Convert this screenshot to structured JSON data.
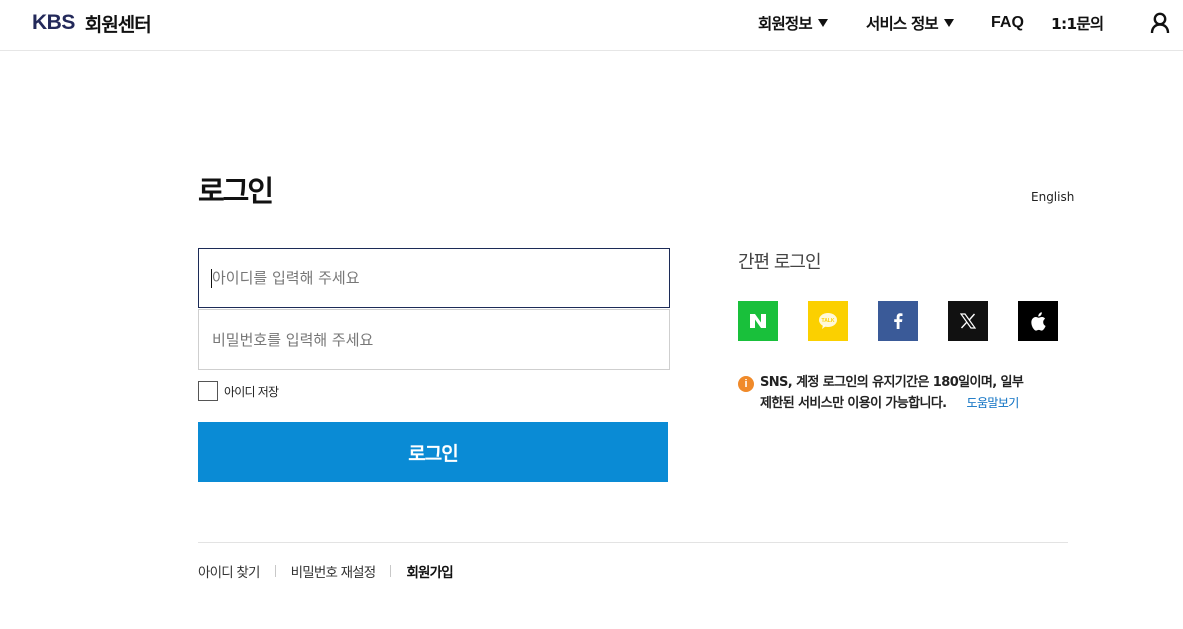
{
  "header": {
    "logo_brand": "KBS",
    "logo_title": "회원센터",
    "nav": [
      {
        "label": "회원정보",
        "has_dropdown": true
      },
      {
        "label": "서비스 정보",
        "has_dropdown": true
      },
      {
        "label": "FAQ",
        "has_dropdown": false
      },
      {
        "label": "1:1문의",
        "has_dropdown": false
      }
    ],
    "user_icon": "user-icon"
  },
  "login": {
    "title": "로그인",
    "language_link": "English",
    "id_placeholder": "아이디를 입력해 주세요",
    "pw_placeholder": "비밀번호를 입력해 주세요",
    "remember_label": "아이디 저장",
    "remember_checked": false,
    "submit_label": "로그인"
  },
  "bottom_links": {
    "find_id": "아이디 찾기",
    "reset_pw": "비밀번호 재설정",
    "signup": "회원가입"
  },
  "sns": {
    "title": "간편 로그인",
    "providers": [
      {
        "name": "naver",
        "icon": "naver-icon",
        "color": "#19c03b"
      },
      {
        "name": "kakao",
        "icon": "kakao-icon",
        "color": "#fbd000"
      },
      {
        "name": "facebook",
        "icon": "facebook-icon",
        "color": "#3a5a98"
      },
      {
        "name": "x",
        "icon": "x-icon",
        "color": "#111111"
      },
      {
        "name": "apple",
        "icon": "apple-icon",
        "color": "#000000"
      }
    ],
    "notice_line1": "SNS, 계정 로그인의 유지기간은 180일이며, 일부",
    "notice_line2": "제한된 서비스만 이용이 가능합니다.",
    "help_link": "도움말보기"
  },
  "colors": {
    "brand_navy": "#23295a",
    "primary_blue": "#0a8bd5",
    "notice_orange": "#f08a2a"
  }
}
